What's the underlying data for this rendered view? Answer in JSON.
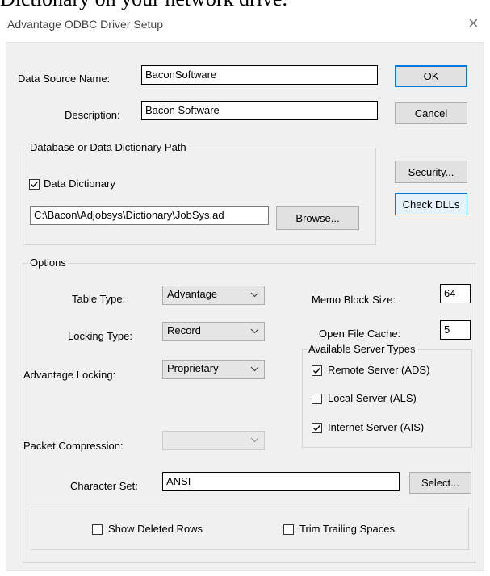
{
  "document_fragment": "Dictionary on your network drive.",
  "window": {
    "title": "Advantage ODBC Driver Setup",
    "close_glyph": "×"
  },
  "fields": {
    "dsn": {
      "label": "Data Source Name:",
      "value": "BaconSoftware"
    },
    "description": {
      "label": "Description:",
      "value": "Bacon Software"
    }
  },
  "buttons": {
    "ok": "OK",
    "cancel": "Cancel",
    "security": "Security...",
    "check_dlls": "Check DLLs",
    "browse": "Browse...",
    "select": "Select..."
  },
  "db_group": {
    "label": "Database or Data Dictionary Path",
    "data_dictionary": {
      "label": "Data Dictionary",
      "checked": true
    },
    "path": "C:\\Bacon\\Adjobsys\\Dictionary\\JobSys.ad"
  },
  "options": {
    "label": "Options",
    "table_type": {
      "label": "Table Type:",
      "value": "Advantage"
    },
    "locking_type": {
      "label": "Locking Type:",
      "value": "Record"
    },
    "advantage_locking": {
      "label": "Advantage Locking:",
      "value": "Proprietary"
    },
    "packet_compression": {
      "label": "Packet Compression:",
      "value": ""
    },
    "memo_block_size": {
      "label": "Memo Block Size:",
      "value": "64"
    },
    "open_file_cache": {
      "label": "Open File Cache:",
      "value": "5"
    },
    "server_types": {
      "label": "Available Server Types",
      "remote": {
        "label": "Remote Server (ADS)",
        "checked": true
      },
      "local": {
        "label": "Local Server (ALS)",
        "checked": false
      },
      "internet": {
        "label": "Internet Server (AIS)",
        "checked": true
      }
    },
    "character_set": {
      "label": "Character Set:",
      "value": "ANSI"
    },
    "show_deleted_rows": {
      "label": "Show Deleted Rows",
      "checked": false
    },
    "trim_trailing_spaces": {
      "label": "Trim Trailing Spaces",
      "checked": false
    }
  },
  "colors": {
    "dialog_bg": "#f0f0f0",
    "focus_blue": "#0078d7"
  }
}
